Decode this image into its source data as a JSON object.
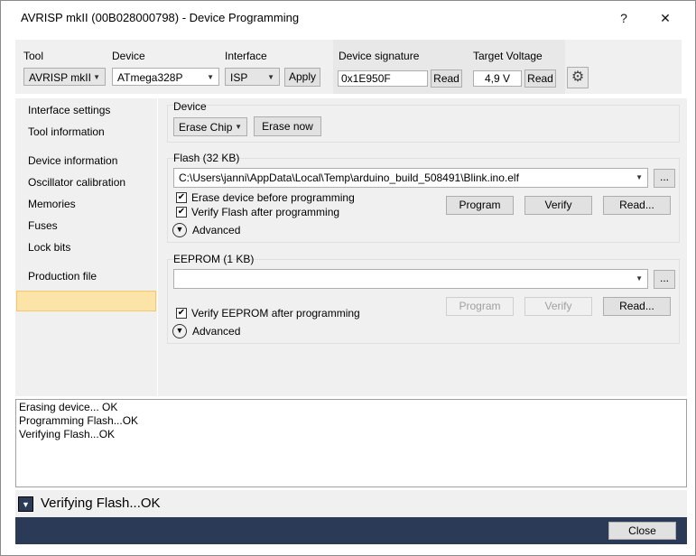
{
  "window": {
    "title": "AVRISP mkII (00B028000798) - Device Programming",
    "help_label": "?",
    "close_label": "✕"
  },
  "toolbar": {
    "tool_label": "Tool",
    "tool_value": "AVRISP mkII",
    "device_label": "Device",
    "device_value": "ATmega328P",
    "interface_label": "Interface",
    "interface_value": "ISP",
    "apply_label": "Apply",
    "signature_label": "Device signature",
    "signature_value": "0x1E950F",
    "signature_read": "Read",
    "voltage_label": "Target Voltage",
    "voltage_value": "4,9 V",
    "voltage_read": "Read"
  },
  "sidebar": {
    "items": [
      {
        "label": "Interface settings"
      },
      {
        "label": "Tool information"
      },
      {
        "label": "Device information"
      },
      {
        "label": "Oscillator calibration"
      },
      {
        "label": "Memories"
      },
      {
        "label": "Fuses"
      },
      {
        "label": "Lock bits"
      },
      {
        "label": "Production file"
      }
    ],
    "selected": "Memories"
  },
  "device_group": {
    "title": "Device",
    "erase_select": "Erase Chip",
    "erase_now": "Erase now"
  },
  "flash_group": {
    "title": "Flash (32 KB)",
    "path": "C:\\Users\\janni\\AppData\\Local\\Temp\\arduino_build_508491\\Blink.ino.elf",
    "browse": "...",
    "erase_before": "Erase device before programming",
    "verify_after": "Verify Flash after programming",
    "program": "Program",
    "verify": "Verify",
    "read": "Read...",
    "advanced": "Advanced"
  },
  "eeprom_group": {
    "title": "EEPROM (1 KB)",
    "path": "",
    "browse": "...",
    "verify_after": "Verify EEPROM after programming",
    "program": "Program",
    "verify": "Verify",
    "read": "Read...",
    "advanced": "Advanced"
  },
  "log": {
    "lines": [
      "Erasing device... OK",
      "Programming Flash...OK",
      "Verifying Flash...OK"
    ]
  },
  "status": {
    "text": "Verifying Flash...OK"
  },
  "footer": {
    "close_label": "Close"
  },
  "colors": {
    "selection": "#fce4a8",
    "footer": "#2b3a57",
    "panel": "#f0f0f0"
  }
}
